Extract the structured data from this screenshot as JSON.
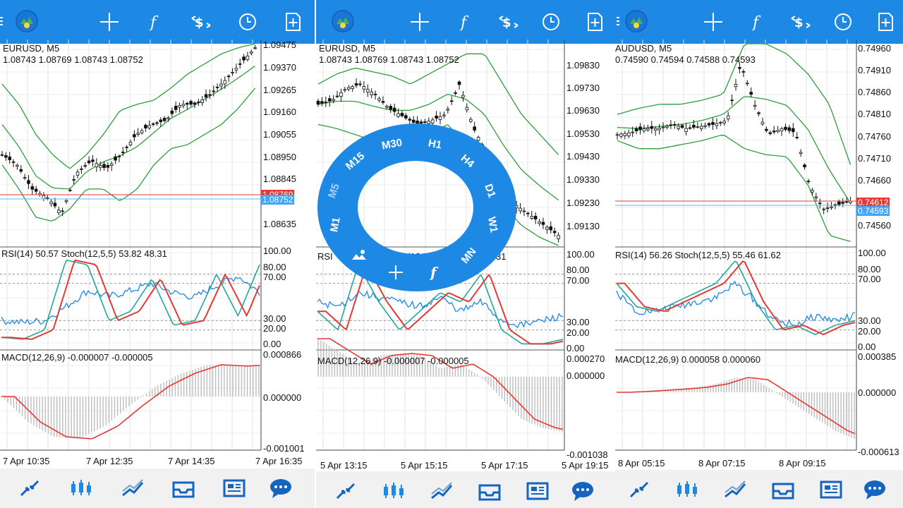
{
  "panels": [
    {
      "symbol_title": "EURUSD, M5",
      "ohlc": "1.08743 1.08769 1.08743 1.08752",
      "price_axis": [
        "1.09475",
        "1.09370",
        "1.09265",
        "1.09160",
        "1.09055",
        "1.08950",
        "1.08845",
        "1.08635"
      ],
      "price_tags": [
        {
          "text": "1.08769",
          "color": "#e53935"
        },
        {
          "text": "1.08752",
          "color": "#42a5f5"
        }
      ],
      "osc_title": "RSI(14) 50.57 Stoch(12,5,5) 53.82 48.31",
      "osc_axis": [
        "100.00",
        "80.00",
        "70.00",
        "30.00",
        "20.00",
        "0.00"
      ],
      "macd_title": "MACD(12,26,9) -0.000007 -0.000005",
      "macd_axis": [
        "0.000866",
        "0.000000",
        "-0.001001"
      ],
      "time_axis": [
        "7 Apr 10:35",
        "7 Apr 12:35",
        "7 Apr 14:35",
        "7 Apr 16:35"
      ]
    },
    {
      "symbol_title": "EURUSD, M5",
      "ohlc": "1.08743 1.08769 1.08743 1.08752",
      "price_axis": [
        "1.09830",
        "1.09730",
        "1.09630",
        "1.09530",
        "1.09430",
        "1.09330",
        "1.09230",
        "1.09130"
      ],
      "osc_title": "RSI(14) 50.57 Stoch(12,5,5) 53.82 48.31",
      "osc_title_visible": "RSI",
      "osc_title_tail": "Stoch(12,5",
      "osc_title_end": "31",
      "osc_axis": [
        "100.00",
        "80.00",
        "70.00",
        "30.00",
        "20.00",
        "0.00"
      ],
      "macd_title": "MACD(12,26,9) -0.000007 -0.000005",
      "macd_axis": [
        "0.000270",
        "0.000000",
        "-0.001038"
      ],
      "time_axis": [
        "5 Apr 13:15",
        "5 Apr 15:15",
        "5 Apr 17:15",
        "5 Apr 19:15"
      ]
    },
    {
      "symbol_title": "AUDUSD, M5",
      "ohlc": "0.74590 0.74594 0.74588 0.74593",
      "price_axis": [
        "0.74960",
        "0.74910",
        "0.74860",
        "0.74810",
        "0.74760",
        "0.74710",
        "0.74660",
        "0.74560"
      ],
      "price_tags": [
        {
          "text": "0.74612",
          "color": "#e53935"
        },
        {
          "text": "0.74593",
          "color": "#42a5f5"
        }
      ],
      "osc_title": "RSI(14) 56.26 Stoch(12,5,5) 55.46 61.62",
      "osc_axis": [
        "100.00",
        "80.00",
        "70.00",
        "30.00",
        "20.00",
        "0.00"
      ],
      "macd_title": "MACD(12,26,9) 0.000058 0.000060",
      "macd_axis": [
        "0.000385",
        "0.000000",
        "-0.000613"
      ],
      "time_axis": [
        "8 Apr 05:15",
        "8 Apr 07:15",
        "8 Apr 09:15"
      ]
    }
  ],
  "timeframes": [
    "M1",
    "M5",
    "M15",
    "M30",
    "H1",
    "H4",
    "D1",
    "W1",
    "MN"
  ],
  "ring_tools": [
    "f"
  ],
  "toolbar_icons": [
    "crosshair-icon",
    "function-icon",
    "currency-icon",
    "clock-icon",
    "new-order-icon"
  ],
  "bottom_nav": [
    "quotes-icon",
    "chart-icon",
    "trade-icon",
    "history-icon",
    "news-icon",
    "chat-icon"
  ],
  "colors": {
    "accent": "#1e88e5",
    "bands": "#2e9e3e",
    "rsi": "#1e88e5",
    "stoch_main": "#26a69a",
    "stoch_signal": "#e53935",
    "macd": "#e53935"
  }
}
